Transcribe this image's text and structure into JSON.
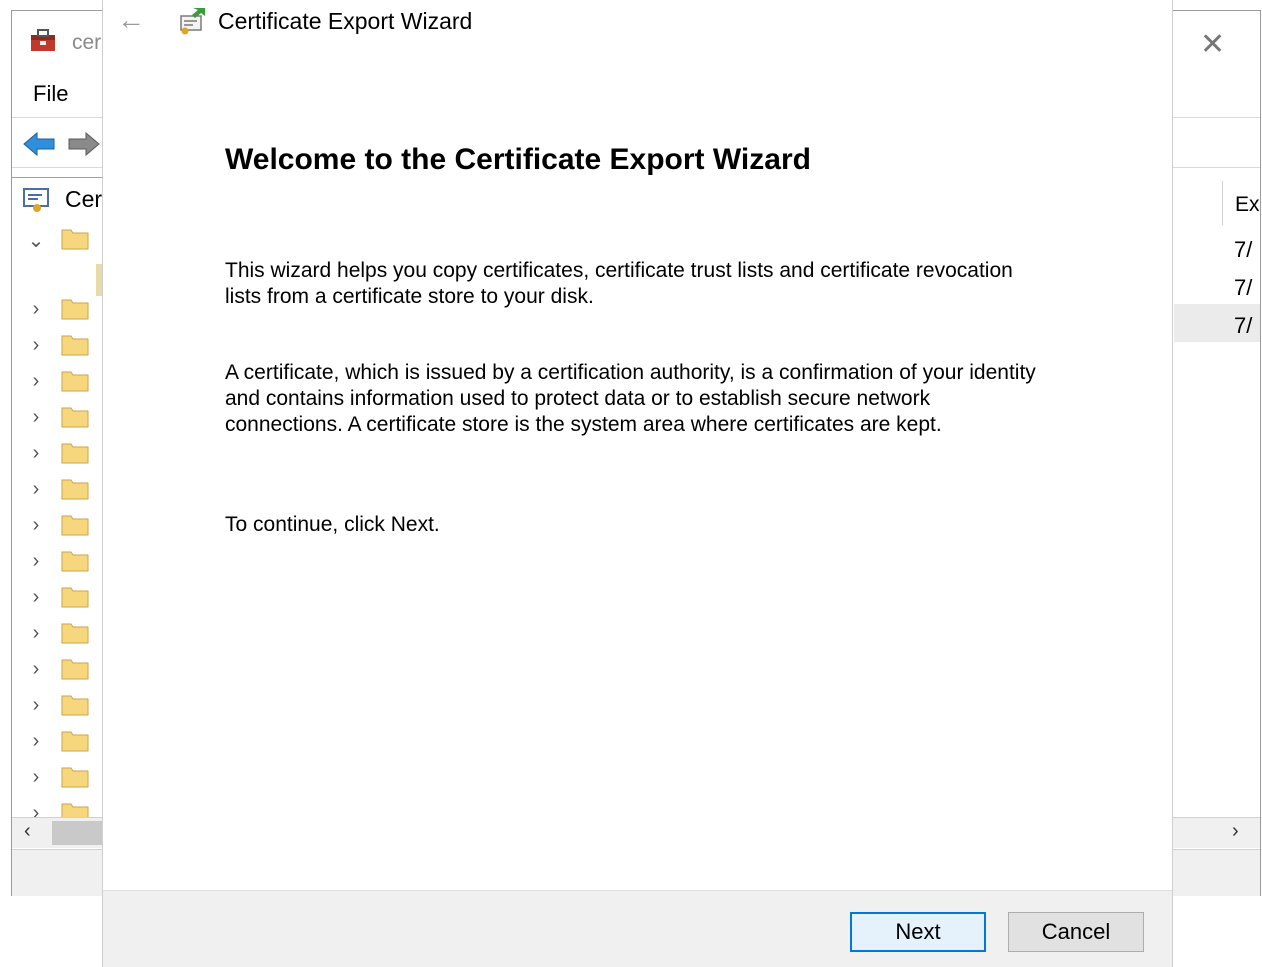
{
  "mmc": {
    "title": "cer",
    "menu": {
      "file": "File"
    },
    "tree": {
      "root_label": "Cer"
    },
    "right_pane": {
      "header": "Ex",
      "cells": [
        "7/",
        "7/",
        "7/"
      ]
    }
  },
  "wizard": {
    "title": "Certificate Export Wizard",
    "heading": "Welcome to the Certificate Export Wizard",
    "paragraph1_line1": "This wizard helps you copy certificates, certificate trust lists and certificate revocation",
    "paragraph1_line2": "lists from a certificate store to your disk.",
    "paragraph2_line1": "A certificate, which is issued by a certification authority, is a confirmation of your identity",
    "paragraph2_line2": "and contains information used to protect data or to establish secure network",
    "paragraph2_line3": "connections. A certificate store is the system area where certificates are kept.",
    "paragraph3": "To continue, click Next.",
    "buttons": {
      "next": "Next",
      "cancel": "Cancel"
    }
  },
  "icons": {
    "back": "back-arrow-icon",
    "forward": "forward-arrow-icon",
    "close": "close-icon",
    "folder": "folder-icon",
    "chevron_right": "chevron-right-icon",
    "chevron_down": "chevron-down-icon"
  },
  "colors": {
    "accent": "#0078d7",
    "folder": "#f6d77e",
    "arrow_blue": "#2f8fdc",
    "footer_bg": "#f0f0f0"
  }
}
